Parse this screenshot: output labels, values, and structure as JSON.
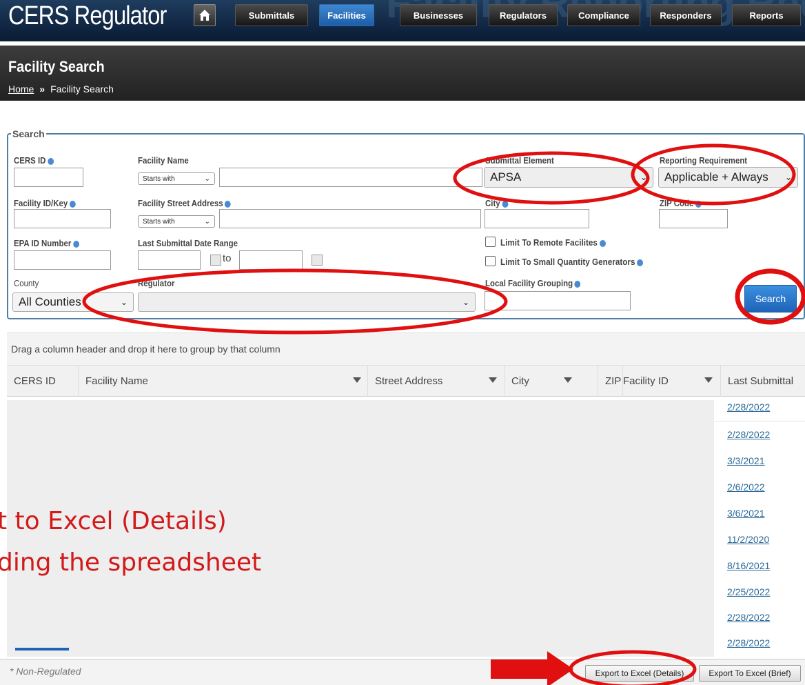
{
  "app": {
    "title": "CERS Regulator",
    "banner_text": "Facility Reporting Requirements"
  },
  "nav": [
    {
      "label": "Submittals",
      "active": false
    },
    {
      "label": "Facilities",
      "active": true
    },
    {
      "label": "Businesses",
      "active": false
    },
    {
      "label": "Regulators",
      "active": false
    },
    {
      "label": "Compliance",
      "active": false
    },
    {
      "label": "Responders",
      "active": false
    },
    {
      "label": "Reports",
      "active": false
    }
  ],
  "page": {
    "title": "Facility Search",
    "breadcrumb": {
      "home": "Home",
      "sep": "»",
      "current": "Facility Search"
    }
  },
  "search": {
    "legend": "Search",
    "cers_id_label": "CERS ID",
    "facility_name_label": "Facility Name",
    "facility_name_mode": "Starts with",
    "submittal_element_label": "Submittal Element",
    "submittal_element_value": "APSA",
    "reporting_requirement_label": "Reporting Requirement",
    "reporting_requirement_value": "Applicable + Always",
    "facility_id_label": "Facility ID/Key",
    "street_address_label": "Facility Street Address",
    "street_address_mode": "Starts with",
    "city_label": "City",
    "zip_label": "ZIP Code",
    "epa_id_label": "EPA ID Number",
    "date_range_label": "Last Submittal Date Range",
    "date_to": "to",
    "remote_label": "Limit To Remote Facilites",
    "sqg_label": "Limit To Small Quantity Generators",
    "county_label": "County",
    "county_value": "All Counties",
    "regulator_label": "Regulator",
    "regulator_value": "",
    "local_grouping_label": "Local Facility Grouping",
    "search_button": "Search"
  },
  "grid": {
    "group_hint": "Drag a column header and drop it here to group by that column",
    "columns": [
      "CERS ID",
      "Facility Name",
      "Street Address",
      "City",
      "ZIP",
      "Facility ID",
      "Last Submittal"
    ],
    "last_submittal": [
      "2/28/2022",
      "2/28/2022",
      "3/3/2021",
      "2/6/2022",
      "3/6/2021",
      "11/2/2020",
      "8/16/2021",
      "2/25/2022",
      "2/28/2022",
      "2/28/2022"
    ]
  },
  "footer": {
    "note": "* Non-Regulated",
    "export_details": "Export to Excel (Details)",
    "export_brief": "Export To Excel (Brief)"
  },
  "annotation": {
    "line1": "t to Excel (Details)",
    "line2": "ding the spreadsheet",
    "color": "#d21a1a"
  },
  "icons": {
    "home": "home-icon",
    "info": "info-icon",
    "calendar": "calendar-icon",
    "filter": "filter-icon",
    "arrow": "arrow-right-icon"
  }
}
